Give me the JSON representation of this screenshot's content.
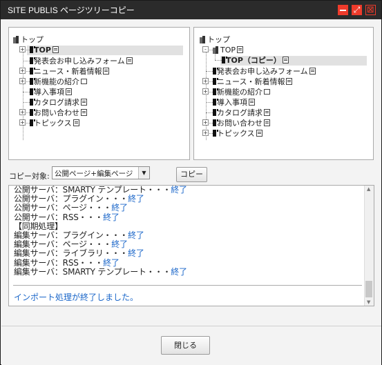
{
  "window": {
    "title": "SITE PUBLIS ページツリーコピー",
    "maximize_glyph": "⤢",
    "close_glyph": "⊠"
  },
  "source_tree": {
    "root": "トップ",
    "items": [
      {
        "label": "TOP",
        "bold": true,
        "selected": true,
        "expander": "+"
      },
      {
        "label": "発表会お申し込みフォーム",
        "expander": ""
      },
      {
        "label": "ニュース・新着情報",
        "expander": "+"
      },
      {
        "label": "新機能の紹介",
        "expander": "+"
      },
      {
        "label": "導入事項",
        "expander": ""
      },
      {
        "label": "カタログ請求",
        "expander": ""
      },
      {
        "label": "お問い合わせ",
        "expander": "+"
      },
      {
        "label": "トピックス",
        "expander": "+"
      }
    ]
  },
  "target_tree": {
    "root": "トップ",
    "items": [
      {
        "label": "TOP",
        "expander": "-"
      },
      {
        "label": "TOP（コピー）",
        "bold": true,
        "selected": true
      },
      {
        "label": "発表会お申し込みフォーム",
        "expander": ""
      },
      {
        "label": "ニュース・新着情報",
        "expander": "+"
      },
      {
        "label": "新機能の紹介",
        "expander": "+"
      },
      {
        "label": "導入事項",
        "expander": ""
      },
      {
        "label": "カタログ請求",
        "expander": ""
      },
      {
        "label": "お問い合わせ",
        "expander": "+"
      },
      {
        "label": "トピックス",
        "expander": "+"
      }
    ]
  },
  "copy_controls": {
    "target_label": "コピー対象:",
    "target_value": "公開ページ+編集ページ",
    "dropdown_glyph": "▼",
    "copy_button": "コピー"
  },
  "log": {
    "lines": [
      {
        "text": "公開サーバ：SMARTY テンプレート・・・",
        "status": "終了"
      },
      {
        "text": "公開サーバ：プラグイン・・・",
        "status": "終了"
      },
      {
        "text": "公開サーバ：ページ・・・",
        "status": "終了"
      },
      {
        "text": "公開サーバ：RSS・・・",
        "status": "終了"
      },
      {
        "text": "【同期処理】",
        "status": ""
      },
      {
        "text": "編集サーバ：プラグイン・・・",
        "status": "終了"
      },
      {
        "text": "編集サーバ：ページ・・・",
        "status": "終了"
      },
      {
        "text": "編集サーバ：ライブラリ・・・",
        "status": "終了"
      },
      {
        "text": "編集サーバ：RSS・・・",
        "status": "終了"
      },
      {
        "text": "編集サーバ：SMARTY テンプレート・・・",
        "status": "終了"
      }
    ],
    "final_message": "インポート処理が終了しました。"
  },
  "footer": {
    "close_button": "閉じる"
  }
}
